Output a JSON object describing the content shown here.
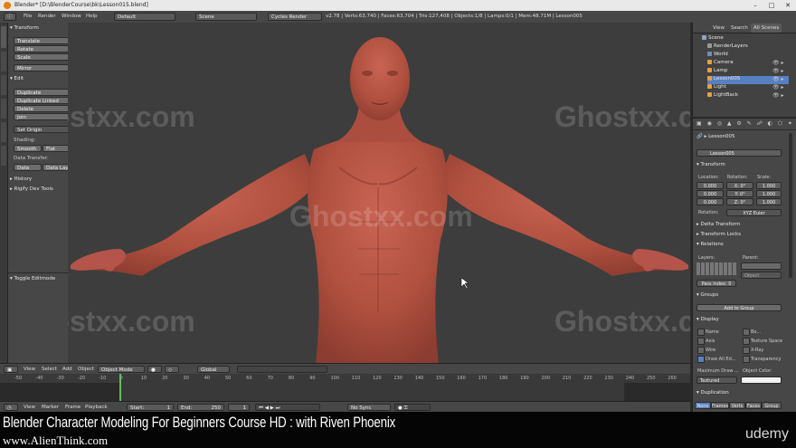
{
  "window": {
    "title": "Blender* [D:\\BlenderCourse\\bk\\Lesson015.blend]"
  },
  "info_bar": {
    "menus": [
      "File",
      "Render",
      "Window",
      "Help"
    ],
    "layout": "Default",
    "scene": "Scene",
    "engine": "Cycles Render",
    "stats": "v2.78 | Verts:63,740 | Faces:63,704 | Tris:127,408 | Objects:1/8 | Lamps:0/1 | Mem:48.71M | Lesson005"
  },
  "tool_shelf": {
    "transform_header": "Transform",
    "transform_buttons": [
      "Translate",
      "Rotate",
      "Scale"
    ],
    "mirror": "Mirror",
    "edit_header": "Edit",
    "edit_buttons": [
      "Duplicate",
      "Duplicate Linked",
      "Delete",
      "Join"
    ],
    "set_origin": "Set Origin",
    "shading_label": "Shading:",
    "smooth": "Smooth",
    "flat": "Flat",
    "data_transfer_label": "Data Transfer:",
    "data": "Data",
    "data_layout": "Data Layo",
    "history": "History",
    "rigify": "Rigify Dev Tools",
    "toggle_editmode": "Toggle Editmode"
  },
  "watermarks": [
    "Ghostxx.com",
    "Ghostxx.com",
    "Ghostxx.com",
    "Ghostxx.com",
    "Ghostxx.com",
    "Ghostxx.com"
  ],
  "viewport_header": {
    "menus": [
      "View",
      "Select",
      "Add",
      "Object"
    ],
    "mode": "Object Mode",
    "orientation": "Global"
  },
  "timeline": {
    "ticks": [
      "-50",
      "-40",
      "-30",
      "-20",
      "-10",
      "0",
      "10",
      "20",
      "30",
      "40",
      "50",
      "60",
      "70",
      "80",
      "90",
      "100",
      "110",
      "120",
      "130",
      "140",
      "150",
      "160",
      "170",
      "180",
      "190",
      "200",
      "210",
      "220",
      "230",
      "240",
      "250",
      "260"
    ],
    "menus": [
      "View",
      "Marker",
      "Frame",
      "Playback"
    ],
    "start_label": "Start:",
    "start_value": "1",
    "end_label": "End:",
    "end_value": "250",
    "current_frame": "1",
    "sync": "No Sync"
  },
  "outliner": {
    "tabs": [
      "View",
      "Search",
      "All Scenes"
    ],
    "items": [
      {
        "label": "Scene",
        "color": "#8fa6c4"
      },
      {
        "label": "RenderLayers",
        "color": "#9a9a9a"
      },
      {
        "label": "World",
        "color": "#6f8fb3"
      },
      {
        "label": "Camera",
        "color": "#e6a040"
      },
      {
        "label": "Lamp",
        "color": "#e6a040"
      },
      {
        "label": "Lesson005",
        "color": "#e6a040"
      },
      {
        "label": "Light",
        "color": "#e6a040"
      },
      {
        "label": "LightBack",
        "color": "#e6a040"
      }
    ]
  },
  "properties": {
    "breadcrumb": "Lesson005",
    "object_name": "Lesson005",
    "transform_header": "Transform",
    "location_label": "Location:",
    "rotation_label": "Rotation:",
    "scale_label": "Scale:",
    "location": [
      "0.000",
      "0.000",
      "0.000"
    ],
    "rotation": [
      "X:  0°",
      "Y:  0°",
      "Z:  0°"
    ],
    "scale": [
      "1.000",
      "1.000",
      "1.000"
    ],
    "rotation_mode_label": "Rotation:",
    "rotation_mode": "XYZ Euler",
    "delta_transform": "Delta Transform",
    "transform_locks": "Transform Locks",
    "relations_header": "Relations",
    "layers_label": "Layers:",
    "parent_label": "Parent:",
    "object_label": "Object",
    "pass_index": "Pass Index:  0",
    "groups_header": "Groups",
    "add_to_group": "Add to Group",
    "display_header": "Display",
    "display_checks": [
      "Name",
      "Axis",
      "Wire",
      "Draw All Ed..."
    ],
    "display_checks_right": [
      "Bo...",
      "Texture Space",
      "X-Ray",
      "Transparency"
    ],
    "max_draw_label": "Maximum Draw ...",
    "object_color_label": "Object Color:",
    "draw_type": "Textured",
    "duplication_header": "Duplication",
    "dup_tabs": [
      "None",
      "Frames",
      "Verts",
      "Faces",
      "Group"
    ]
  },
  "caption": {
    "title": "Blender Character Modeling For Beginners Course HD : with Riven Phoenix",
    "site": "www.AlienThink.com",
    "brand": "udemy"
  },
  "colors": {
    "accent": "#e87d0d",
    "skin": "#b55548",
    "selected": "#5680c2"
  }
}
